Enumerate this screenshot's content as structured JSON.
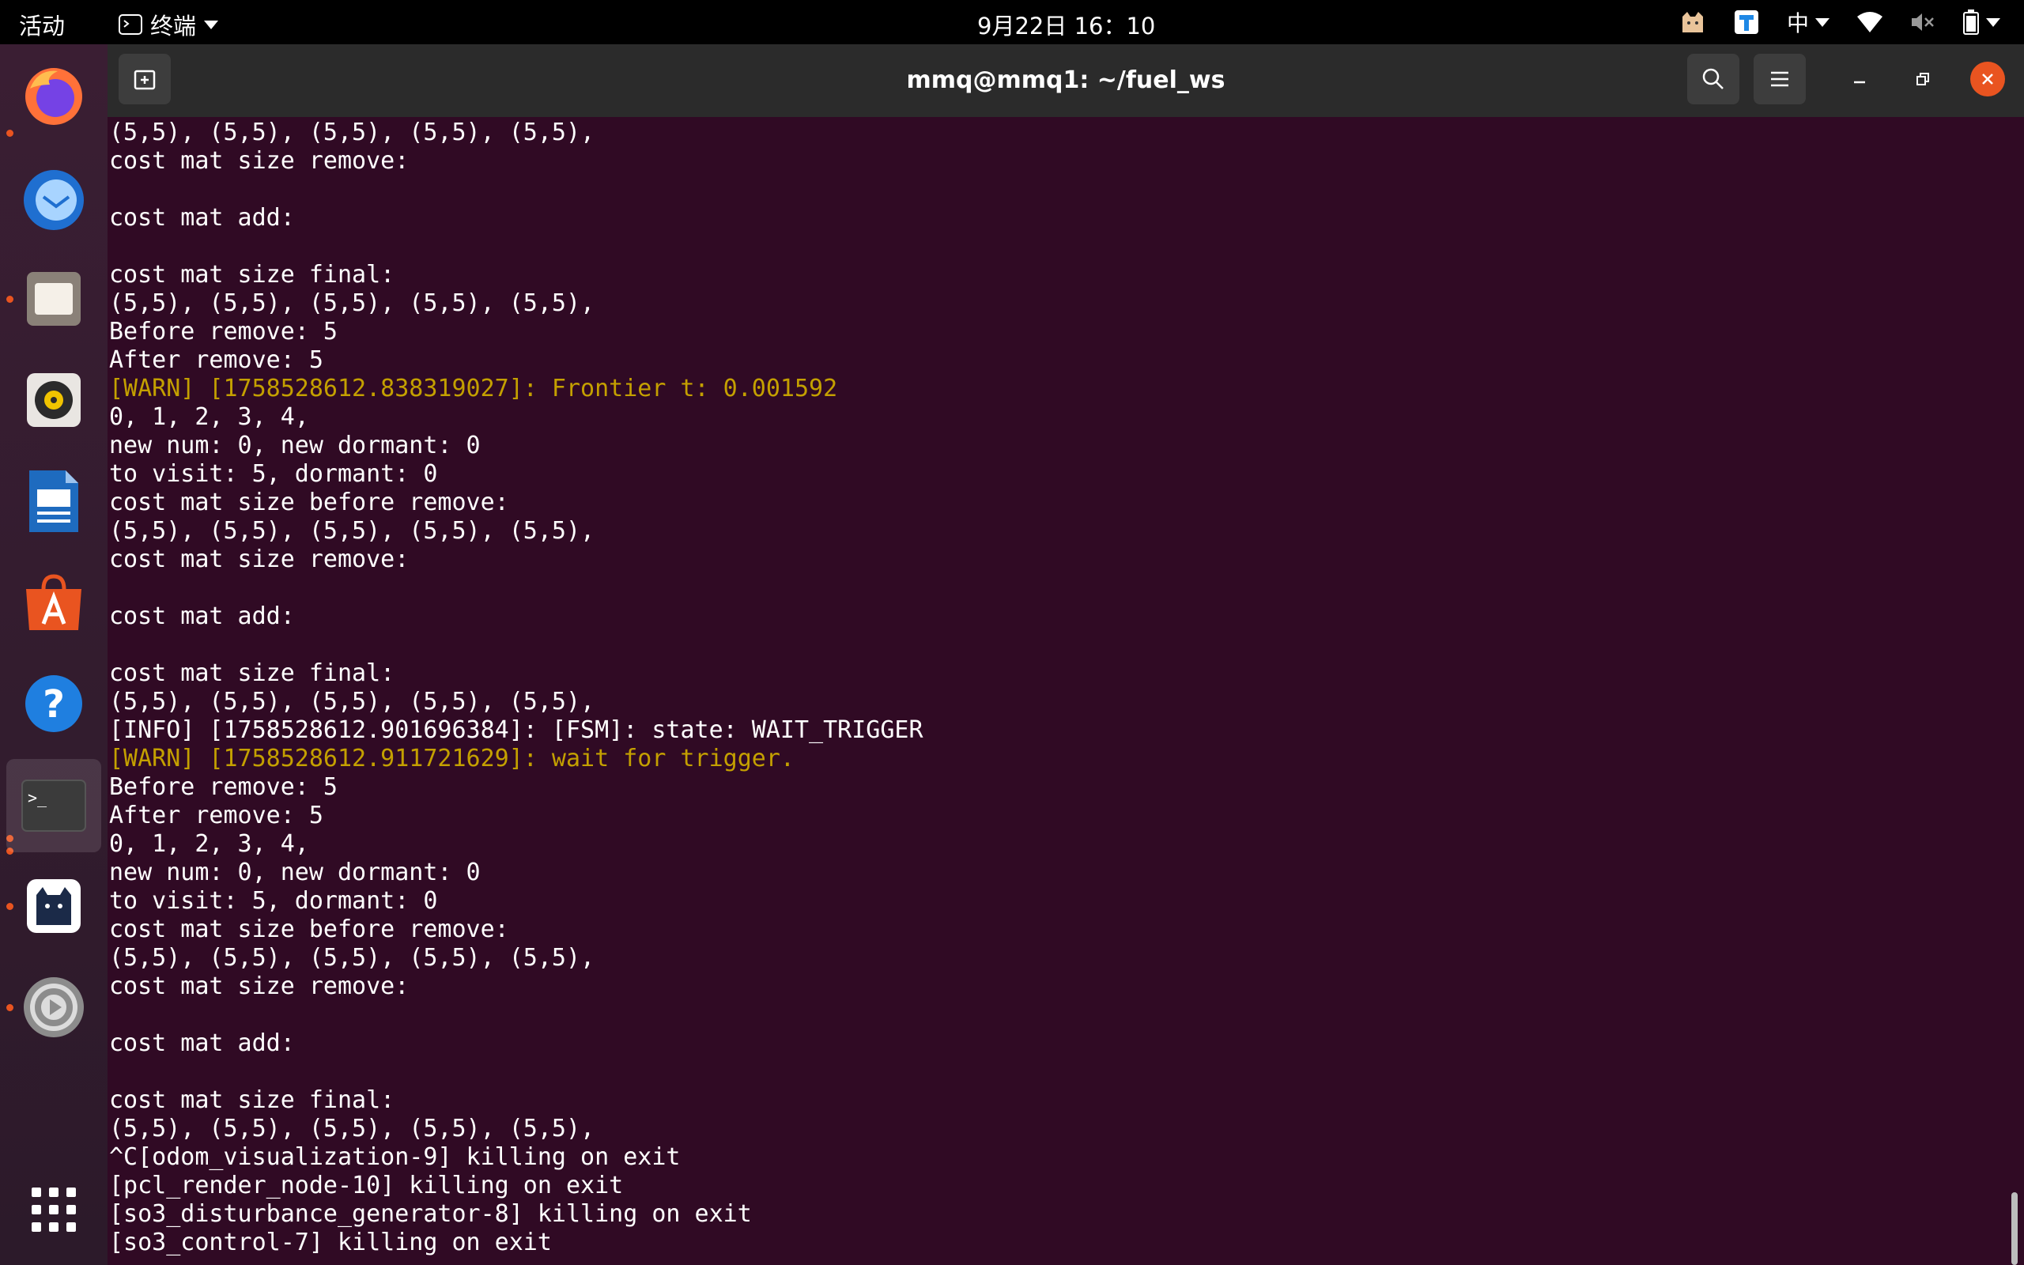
{
  "topbar": {
    "activities": "活动",
    "app_name": "终端",
    "clock": "9月22日  16：10",
    "input_method": "中"
  },
  "dock": {
    "items": [
      {
        "name": "firefox",
        "running": true
      },
      {
        "name": "thunderbird",
        "running": false
      },
      {
        "name": "files",
        "running": true
      },
      {
        "name": "rhythmbox",
        "running": false
      },
      {
        "name": "libreoffice-writer",
        "running": false
      },
      {
        "name": "app-center",
        "running": false
      },
      {
        "name": "help",
        "running": false
      },
      {
        "name": "terminal",
        "running": true
      },
      {
        "name": "cat-app",
        "running": true
      },
      {
        "name": "settings",
        "running": true
      },
      {
        "name": "show-apps",
        "running": false
      }
    ]
  },
  "window": {
    "title": "mmq@mmq1: ~/fuel_ws"
  },
  "terminal": {
    "lines": [
      {
        "text": "(5,5), (5,5), (5,5), (5,5), (5,5),",
        "type": "normal"
      },
      {
        "text": "cost mat size remove:",
        "type": "normal"
      },
      {
        "text": "",
        "type": "normal"
      },
      {
        "text": "cost mat add:",
        "type": "normal"
      },
      {
        "text": "",
        "type": "normal"
      },
      {
        "text": "cost mat size final:",
        "type": "normal"
      },
      {
        "text": "(5,5), (5,5), (5,5), (5,5), (5,5),",
        "type": "normal"
      },
      {
        "text": "Before remove: 5",
        "type": "normal"
      },
      {
        "text": "After remove: 5",
        "type": "normal"
      },
      {
        "text": "[WARN] [1758528612.838319027]: Frontier t: 0.001592",
        "type": "warn"
      },
      {
        "text": "0, 1, 2, 3, 4,",
        "type": "normal"
      },
      {
        "text": "new num: 0, new dormant: 0",
        "type": "normal"
      },
      {
        "text": "to visit: 5, dormant: 0",
        "type": "normal"
      },
      {
        "text": "cost mat size before remove:",
        "type": "normal"
      },
      {
        "text": "(5,5), (5,5), (5,5), (5,5), (5,5),",
        "type": "normal"
      },
      {
        "text": "cost mat size remove:",
        "type": "normal"
      },
      {
        "text": "",
        "type": "normal"
      },
      {
        "text": "cost mat add:",
        "type": "normal"
      },
      {
        "text": "",
        "type": "normal"
      },
      {
        "text": "cost mat size final:",
        "type": "normal"
      },
      {
        "text": "(5,5), (5,5), (5,5), (5,5), (5,5),",
        "type": "normal"
      },
      {
        "text": "[INFO] [1758528612.901696384]: [FSM]: state: WAIT_TRIGGER",
        "type": "normal"
      },
      {
        "text": "[WARN] [1758528612.911721629]: wait for trigger.",
        "type": "warn"
      },
      {
        "text": "Before remove: 5",
        "type": "normal"
      },
      {
        "text": "After remove: 5",
        "type": "normal"
      },
      {
        "text": "0, 1, 2, 3, 4,",
        "type": "normal"
      },
      {
        "text": "new num: 0, new dormant: 0",
        "type": "normal"
      },
      {
        "text": "to visit: 5, dormant: 0",
        "type": "normal"
      },
      {
        "text": "cost mat size before remove:",
        "type": "normal"
      },
      {
        "text": "(5,5), (5,5), (5,5), (5,5), (5,5),",
        "type": "normal"
      },
      {
        "text": "cost mat size remove:",
        "type": "normal"
      },
      {
        "text": "",
        "type": "normal"
      },
      {
        "text": "cost mat add:",
        "type": "normal"
      },
      {
        "text": "",
        "type": "normal"
      },
      {
        "text": "cost mat size final:",
        "type": "normal"
      },
      {
        "text": "(5,5), (5,5), (5,5), (5,5), (5,5),",
        "type": "normal"
      },
      {
        "text": "^C[odom_visualization-9] killing on exit",
        "type": "normal"
      },
      {
        "text": "[pcl_render_node-10] killing on exit",
        "type": "normal"
      },
      {
        "text": "[so3_disturbance_generator-8] killing on exit",
        "type": "normal"
      },
      {
        "text": "[so3_control-7] killing on exit",
        "type": "normal"
      }
    ]
  }
}
